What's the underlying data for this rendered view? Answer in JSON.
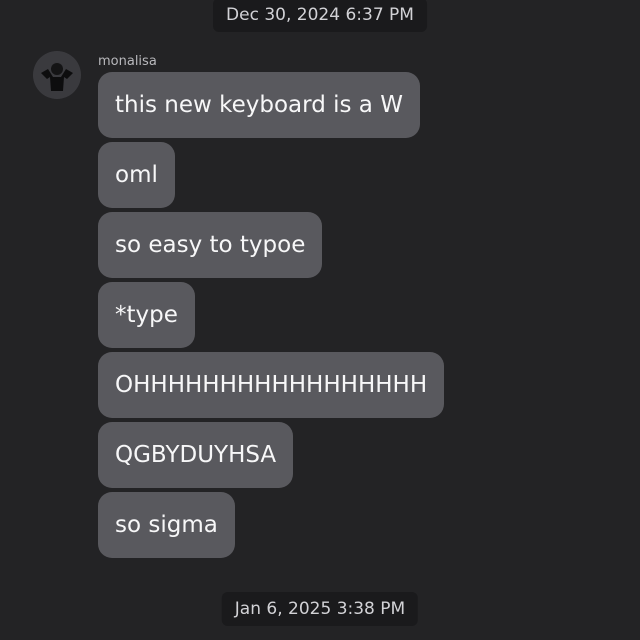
{
  "timestamps": {
    "top": "Dec 30, 2024 6:37 PM",
    "bottom": "Jan 6, 2025 3:38 PM"
  },
  "sender": {
    "name": "monalisa",
    "avatar_icon": "profile-avatar-icon"
  },
  "messages": [
    "this new keyboard is a W",
    "oml",
    "so easy to typoe",
    "*type",
    "OHHHHHHHHHHHHHHHHH",
    "QGBYDUYHSA",
    "so sigma"
  ],
  "colors": {
    "background": "#232325",
    "bubble": "#59595e",
    "bubble_text": "#f7f7f8",
    "timestamp_pill": "#1a1a1c"
  }
}
